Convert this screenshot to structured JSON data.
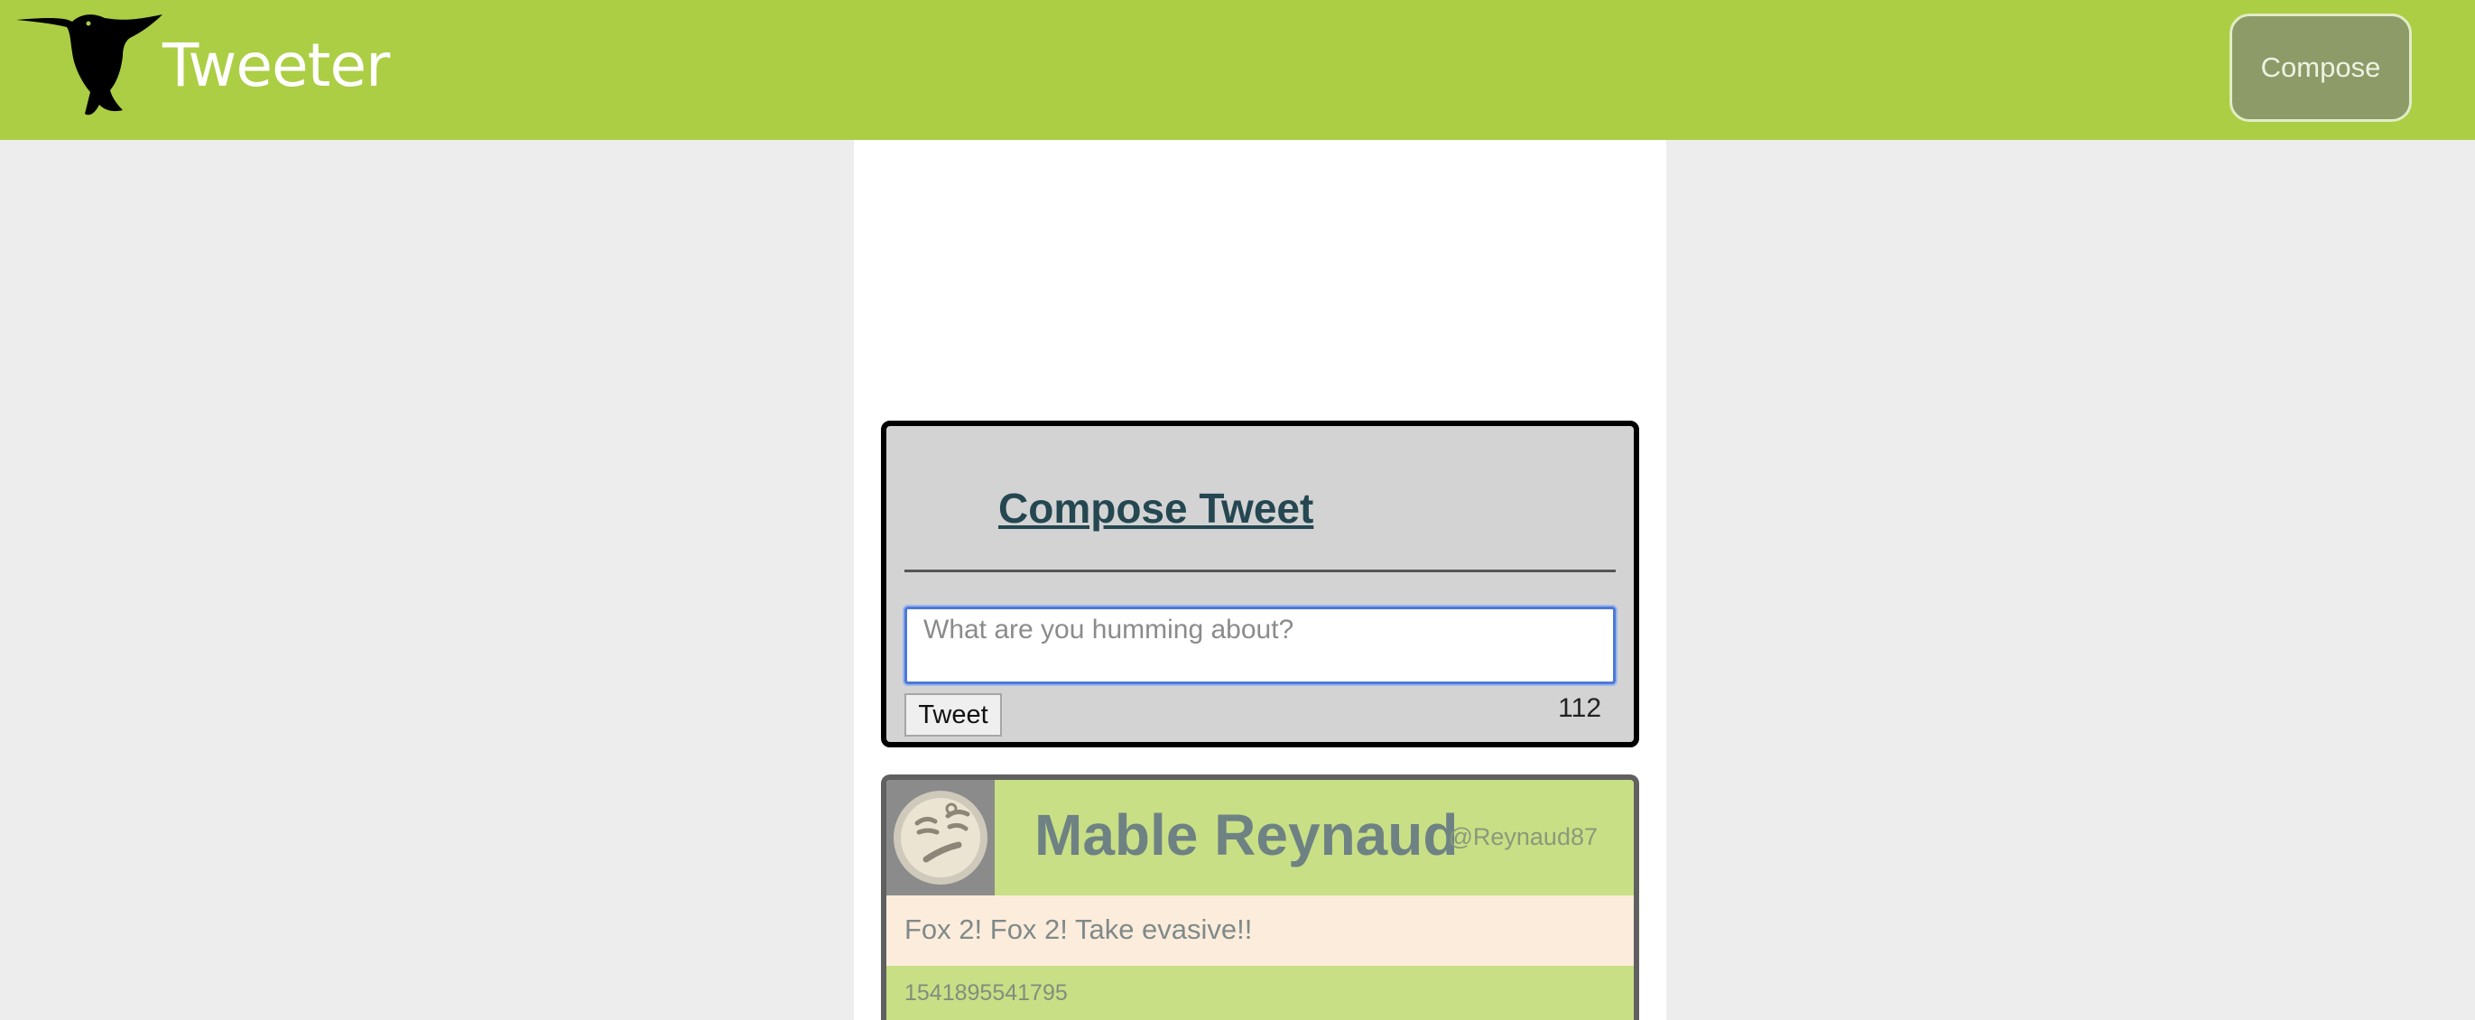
{
  "app": {
    "brand": "Tweeter",
    "compose_button": "Compose",
    "colors": {
      "navbar": "#abce44",
      "background": "#ededed",
      "title": "#244751"
    }
  },
  "compose": {
    "title": "Compose Tweet",
    "placeholder": "What are you humming about?",
    "value": "",
    "submit_label": "Tweet",
    "char_counter": "112"
  },
  "tweets": [
    {
      "name": "Mable Reynaud",
      "handle": "@Reynaud87",
      "text": "Fox 2! Fox 2! Take evasive!!",
      "timestamp": "1541895541795",
      "avatar_icon": "cartoon-face-avatar"
    }
  ]
}
